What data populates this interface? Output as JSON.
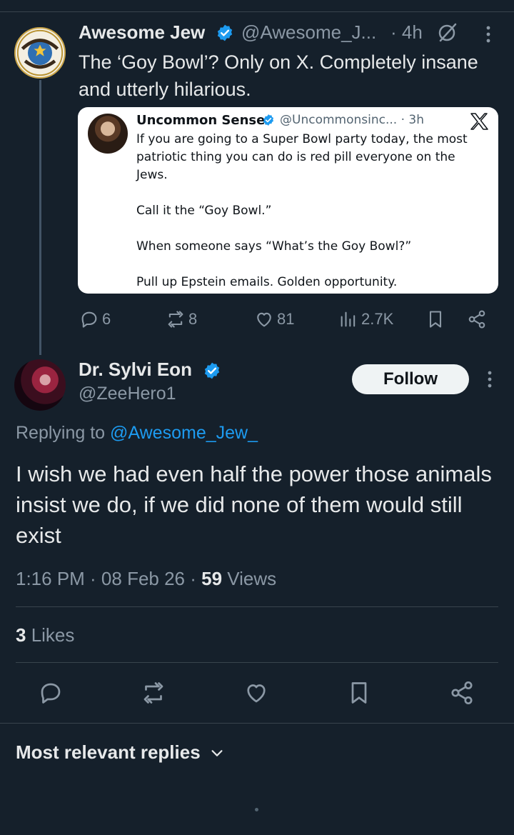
{
  "parent_tweet": {
    "author_name": "Awesome Jew",
    "handle": "@Awesome_J...",
    "time": "· 4h",
    "text": "The ‘Goy Bowl’? Only on X. Completely insane and utterly hilarious.",
    "avatar_text_top": "AWESOME",
    "avatar_text_bottom": "JEW",
    "quoted": {
      "author_name": "Uncommon Sense",
      "handle": "@Uncommonsinc... · 3h",
      "paragraphs": [
        "If you are going to a Super Bowl party today, the most patriotic thing you can do is red pill everyone on the Jews.",
        "Call it the “Goy Bowl.”",
        "When someone says “What’s the Goy Bowl?”",
        "Pull up Epstein emails. Golden opportunity."
      ]
    },
    "actions": {
      "replies": "6",
      "reposts": "8",
      "likes": "81",
      "views": "2.7K"
    }
  },
  "reply_tweet": {
    "author_name": "Dr. Sylvi Eon",
    "handle": "@ZeeHero1",
    "follow_label": "Follow",
    "replying_prefix": "Replying to ",
    "replying_to": "@Awesome_Jew_",
    "text": "I wish we had even half the power those animals insist we do, if we did none of them would still exist",
    "time": "1:16 PM · 08 Feb 26 · ",
    "views_count": "59",
    "views_label": " Views",
    "likes_count": "3",
    "likes_label": " Likes"
  },
  "replies_sort": {
    "label": "Most relevant replies"
  },
  "colors": {
    "background": "#15202b",
    "accent": "#1d9bf0",
    "muted": "#8b98a5"
  }
}
